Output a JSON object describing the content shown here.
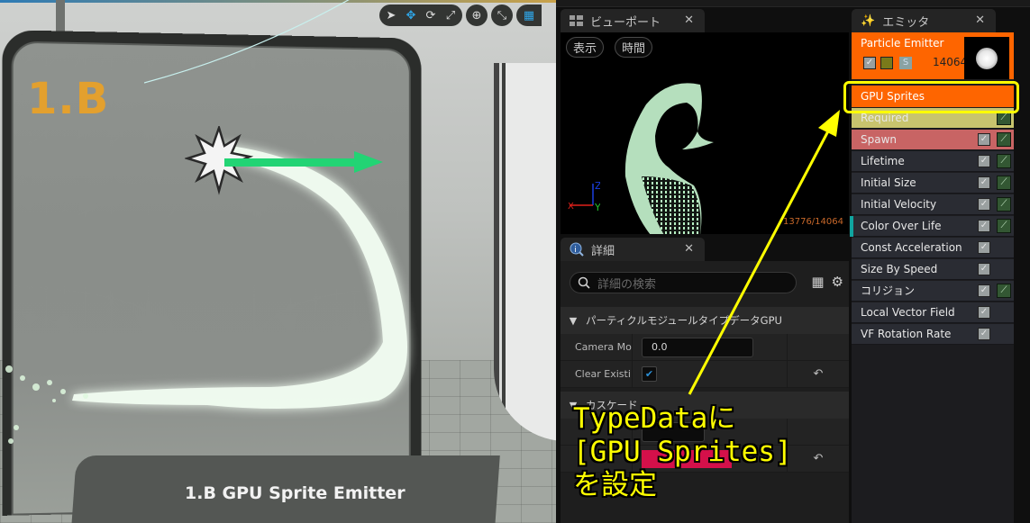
{
  "level_viewport": {
    "sign_number": "1.B",
    "plaque_text": "1.B  GPU Sprite Emitter",
    "toolbar": [
      {
        "icon": "select-arrow-icon",
        "glyph": "➤"
      },
      {
        "icon": "translate-icon",
        "glyph": "✥"
      },
      {
        "icon": "rotate-icon",
        "glyph": "⟳"
      },
      {
        "icon": "scale-icon",
        "glyph": "⤢"
      },
      {
        "icon": "world-local-icon",
        "glyph": "⊕"
      },
      {
        "icon": "surface-snap-icon",
        "glyph": "⤡"
      },
      {
        "icon": "grid-snap-icon",
        "glyph": "▦"
      }
    ]
  },
  "preview_panel": {
    "tab_label": "ビューポート",
    "show_button": "表示",
    "time_button": "時間",
    "axis": {
      "x": "X",
      "y": "Y",
      "z": "Z"
    },
    "particle_counter": "13776/14064",
    "colors": {
      "particles": "#a8f0b8",
      "counter": "#c8682a"
    }
  },
  "details_panel": {
    "tab_label": "詳細",
    "search_placeholder": "詳細の検索",
    "categories": [
      {
        "label": "パーティクルモジュールタイプデータGPU",
        "rows": [
          {
            "name": "Camera Mo",
            "value": "0.0",
            "type": "number"
          },
          {
            "name": "Clear Existi",
            "value": true,
            "type": "checkbox",
            "reset": "↶"
          }
        ]
      },
      {
        "label": "カスケード",
        "rows": [
          {
            "name": "",
            "value": "",
            "type": "number"
          },
          {
            "name": "",
            "value": "",
            "type": "color",
            "reset": "↶"
          }
        ]
      }
    ]
  },
  "emitter_panel": {
    "tab_label": "エミッタ",
    "emitter": {
      "name": "Particle Emitter",
      "particle_count": "14064",
      "solo_label": "S",
      "color": "#fe6500"
    },
    "type_data": "GPU Sprites",
    "modules": [
      {
        "label": "Required",
        "color": "#c8c46e",
        "enabled": false,
        "curve": true
      },
      {
        "label": "Spawn",
        "color": "#c86464",
        "enabled": true,
        "curve": true
      },
      {
        "label": "Lifetime",
        "color": "#2a2c33",
        "enabled": true,
        "curve": true
      },
      {
        "label": "Initial Size",
        "color": "#2a2c33",
        "enabled": true,
        "curve": true
      },
      {
        "label": "Initial Velocity",
        "color": "#2a2c33",
        "enabled": true,
        "curve": true
      },
      {
        "label": "Color Over Life",
        "color": "#2a2c33",
        "enabled": true,
        "curve": true,
        "accent": true
      },
      {
        "label": "Const Acceleration",
        "color": "#2a2c33",
        "enabled": true,
        "curve": false
      },
      {
        "label": "Size By Speed",
        "color": "#2a2c33",
        "enabled": true,
        "curve": false
      },
      {
        "label": "コリジョン",
        "color": "#2a2c33",
        "enabled": true,
        "curve": true
      },
      {
        "label": "Local Vector Field",
        "color": "#2a2c33",
        "enabled": true,
        "curve": false
      },
      {
        "label": "VF Rotation Rate",
        "color": "#2a2c33",
        "enabled": true,
        "curve": false
      }
    ]
  },
  "annotation": {
    "text": "TypeDataに\n[GPU Sprites]\nを設定",
    "color": "#ffff00"
  }
}
